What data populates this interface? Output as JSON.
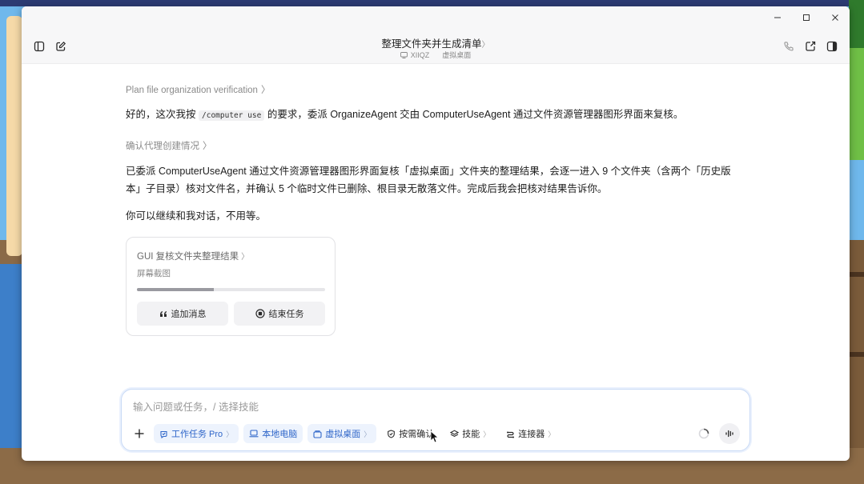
{
  "window": {
    "title": "整理文件夹并生成清单",
    "title_chevron": "〉",
    "subtitle_user": "XIIQZ",
    "subtitle_location": "虚拟桌面"
  },
  "conversation": {
    "step1_link": "Plan file organization verification",
    "step1_chevron": "〉",
    "para1_pre": "好的，这次我按",
    "para1_code": "/computer use",
    "para1_post": "的要求，委派 OrganizeAgent 交由 ComputerUseAgent 通过文件资源管理器图形界面来复核。",
    "step2_link": "确认代理创建情况",
    "step2_chevron": "〉",
    "para2_line1": "已委派 ComputerUseAgent 通过文件资源管理器图形界面复核「虚拟桌面」文件夹的整理结果，会逐一进入 9 个文件夹（含两个「历史版",
    "para2_line2": "本」子目录）核对文件名，并确认 5 个临时文件已删除、根目录无散落文件。完成后我会把核对结果告诉你。",
    "para3": "你可以继续和我对话，不用等。"
  },
  "task_card": {
    "title": "GUI 复核文件夹整理结果",
    "title_chevron": "〉",
    "status": "屏幕截图",
    "progress": 0.41,
    "add_message": "追加消息",
    "end_task": "结束任务"
  },
  "composer": {
    "placeholder": "输入问题或任务，/ 选择技能",
    "chip_work_task": "工作任务 Pro",
    "chip_local": "本地电脑",
    "chip_virtual": "虚拟桌面",
    "chip_confirm": "按需确认",
    "chip_skills": "技能",
    "chip_connectors": "连接器",
    "chevron": "〉"
  },
  "colors": {
    "accent": "#2f66c9",
    "chip_bg": "#edf3fd",
    "text": "#1d1d1d",
    "muted": "#8a8a8a"
  }
}
